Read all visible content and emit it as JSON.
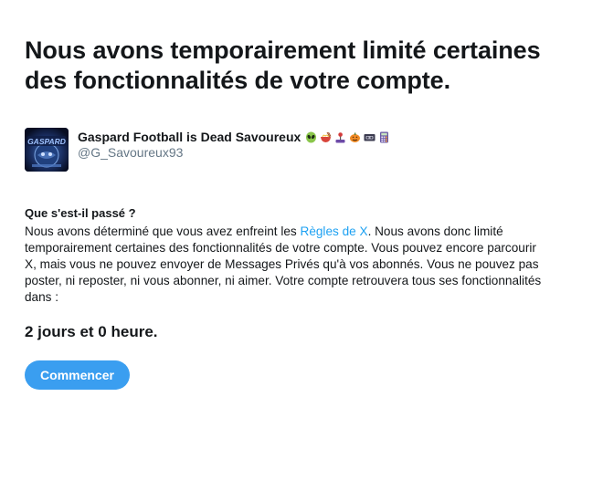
{
  "header": {
    "title": "Nous avons temporairement limité certaines des fonctionnalités de votre compte."
  },
  "account": {
    "display_name": "Gaspard Football is Dead Savoureux",
    "handle": "@G_Savoureux93",
    "avatar_text": "GASPARD",
    "emoji_icons": [
      "alien-icon",
      "noodle-bowl-icon",
      "joystick-icon",
      "pumpkin-icon",
      "vhs-tape-icon",
      "calculator-icon"
    ]
  },
  "explanation": {
    "title": "Que s'est-il passé ?",
    "text_before_link": "Nous avons déterminé que vous avez enfreint les ",
    "link_text": "Règles de X",
    "text_after_link": ". Nous avons donc limité temporairement certaines des fonctionnalités de votre compte. Vous pouvez encore parcourir X, mais vous ne pouvez envoyer de Messages Privés qu'à vos abonnés. Vous ne pouvez pas poster, ni reposter, ni vous abonner, ni aimer. Votre compte retrouvera tous ses fonctionnalités dans :"
  },
  "duration": "2 jours et 0 heure.",
  "actions": {
    "start_label": "Commencer"
  },
  "colors": {
    "text": "#14171a",
    "muted": "#657786",
    "link": "#1da1f2",
    "button": "#3a9ef0"
  }
}
